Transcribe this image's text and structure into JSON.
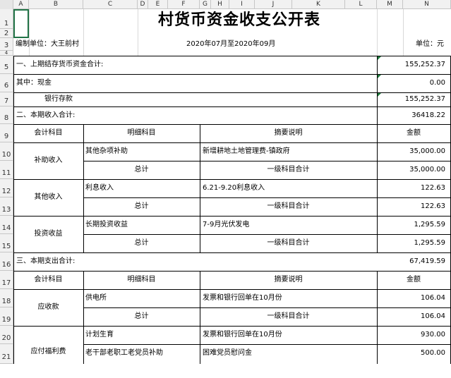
{
  "columns": [
    "A",
    "B",
    "C",
    "D",
    "E",
    "F",
    "G",
    "H",
    "I",
    "J",
    "K",
    "L",
    "M",
    "N"
  ],
  "rows": [
    "1",
    "2",
    "3",
    "4",
    "5",
    "6",
    "7",
    "8",
    "9",
    "10",
    "11",
    "12",
    "13",
    "14",
    "15",
    "16",
    "17",
    "18",
    "19",
    "20",
    "21"
  ],
  "title": "村货币资金收支公开表",
  "org_label": "编制单位：大王前村",
  "period": "2020年07月至2020年09月",
  "unit": "单位：元",
  "prev": {
    "label": "一、上期结存货币资金合计:",
    "value": "155,252.37",
    "cash_label": "其中：现金",
    "cash_value": "0.00",
    "bank_label": "银行存款",
    "bank_value": "155,252.37"
  },
  "income": {
    "label": "二、本期收入合计:",
    "value": "36418.22"
  },
  "expense": {
    "label": "三、本期支出合计:",
    "value": "67,419.59"
  },
  "headers": {
    "subject": "会计科目",
    "detail": "明细科目",
    "summary": "摘要说明",
    "amount": "金额"
  },
  "income_rows": {
    "r10": {
      "subject": "补助收入",
      "detail": "其他杂项补助",
      "summary": "新增耕地土地管理费-镇政府",
      "amount": "35,000.00"
    },
    "r11": {
      "detail": "总计",
      "summary": "一级科目合计",
      "amount": "35,000.00"
    },
    "r12": {
      "subject": "其他收入",
      "detail": "利息收入",
      "summary": "6.21-9.20利息收入",
      "amount": "122.63"
    },
    "r13": {
      "detail": "总计",
      "summary": "一级科目合计",
      "amount": "122.63"
    },
    "r14": {
      "subject": "投资收益",
      "detail": "长期投资收益",
      "summary": "7-9月光伏发电",
      "amount": "1,295.59"
    },
    "r15": {
      "detail": "总计",
      "summary": "一级科目合计",
      "amount": "1,295.59"
    }
  },
  "expense_rows": {
    "r18": {
      "subject": "应收款",
      "detail": "供电所",
      "summary": "发票和银行回单在10月份",
      "amount": "106.04"
    },
    "r19": {
      "detail": "总计",
      "summary": "一级科目合计",
      "amount": "106.04"
    },
    "r20": {
      "subject": "应付福利费",
      "detail": "计划生育",
      "summary": "发票和银行回单在10月份",
      "amount": "930.00"
    },
    "r21": {
      "detail": "老干部老职工老党员补助",
      "summary": "困难党员慰问金",
      "amount": "500.00"
    }
  }
}
